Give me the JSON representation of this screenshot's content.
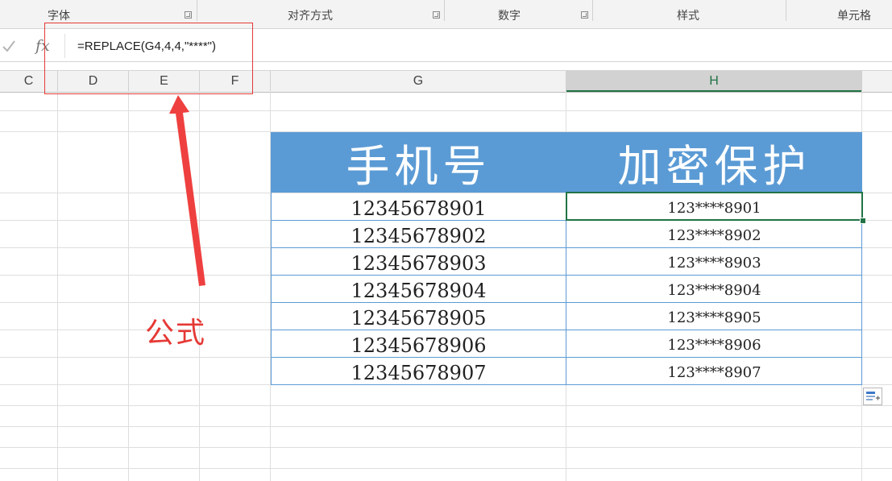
{
  "ribbon": {
    "groups": [
      "字体",
      "对齐方式",
      "数字",
      "样式",
      "单元格"
    ]
  },
  "formula_bar": {
    "formula": "=REPLACE(G4,4,4,\"****\")",
    "fx_label": "fx"
  },
  "columns": [
    "C",
    "D",
    "E",
    "F",
    "G",
    "H"
  ],
  "table": {
    "headers": [
      "手机号",
      "加密保护"
    ],
    "rows": [
      {
        "phone": "12345678901",
        "masked": "123****8901"
      },
      {
        "phone": "12345678902",
        "masked": "123****8902"
      },
      {
        "phone": "12345678903",
        "masked": "123****8903"
      },
      {
        "phone": "12345678904",
        "masked": "123****8904"
      },
      {
        "phone": "12345678905",
        "masked": "123****8905"
      },
      {
        "phone": "12345678906",
        "masked": "123****8906"
      },
      {
        "phone": "12345678907",
        "masked": "123****8907"
      }
    ]
  },
  "annotation": {
    "label": "公式",
    "color": "#e53935"
  },
  "colors": {
    "header_fill": "#5b9bd5",
    "selection": "#217346"
  },
  "icons": [
    "check-icon",
    "fx-icon",
    "dialog-launcher-icon",
    "quick-analysis-icon"
  ]
}
